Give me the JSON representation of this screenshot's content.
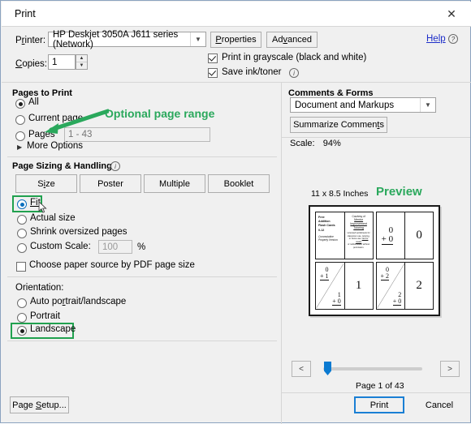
{
  "window": {
    "title": "Print",
    "close_icon": "close-icon"
  },
  "printer": {
    "label": "Printer:",
    "value": "HP Deskjet 3050A J611 series (Network)",
    "properties_label": "Properties",
    "advanced_label": "Advanced",
    "help_label": "Help",
    "help_icon": "question-circle-icon"
  },
  "copies": {
    "label": "Copies:",
    "value": "1"
  },
  "options": {
    "grayscale_label": "Print in grayscale (black and white)",
    "grayscale_checked": true,
    "saveink_label": "Save ink/toner",
    "saveink_checked": true,
    "saveink_info_icon": "info-circle-icon"
  },
  "pages_to_print": {
    "title": "Pages to Print",
    "items": [
      {
        "label": "All",
        "selected": true
      },
      {
        "label": "Current page",
        "selected": false
      },
      {
        "label": "Pages",
        "selected": false
      }
    ],
    "range_placeholder": "1 - 43",
    "more_options_label": "More Options",
    "more_options_icon": "triangle-right-icon"
  },
  "page_sizing": {
    "title": "Page Sizing & Handling",
    "info_icon": "info-circle-icon",
    "buttons": [
      "Size",
      "Poster",
      "Multiple",
      "Booklet"
    ],
    "radios": [
      {
        "label": "Fit",
        "selected": true
      },
      {
        "label": "Actual size",
        "selected": false
      },
      {
        "label": "Shrink oversized pages",
        "selected": false
      },
      {
        "label": "Custom Scale:",
        "selected": false
      }
    ],
    "custom_scale_value": "100",
    "percent_label": "%",
    "paper_source_label": "Choose paper source by PDF page size",
    "paper_source_checked": false
  },
  "orientation": {
    "title": "Orientation:",
    "items": [
      {
        "label": "Auto portrait/landscape",
        "selected": false
      },
      {
        "label": "Portrait",
        "selected": false
      },
      {
        "label": "Landscape",
        "selected": true
      }
    ]
  },
  "comments_forms": {
    "title": "Comments & Forms",
    "value": "Document and Markups",
    "summarize_label": "Summarize Comments"
  },
  "preview": {
    "scale_label": "Scale:",
    "scale_value": "94%",
    "size_label": "11 x 8.5 Inches",
    "page_status": "Page 1 of 43",
    "prev_label": "<",
    "next_label": ">",
    "cards": {
      "title_lines": [
        "Free",
        "Addition",
        "Flash Cards",
        "0-12"
      ],
      "subtitle_lines": [
        "Commutative",
        "Property Version"
      ],
      "courtesy_label": "Courtesy of",
      "courtesy_link": "Mental Improvement Tutoring",
      "courtesy_note": "Licensed worksheets for classroom use, tutoring, or home use. Not for resale or redistribution without permission.",
      "problems": [
        {
          "top": "0",
          "op": "+ 0",
          "answer": "0"
        },
        {
          "top": "0",
          "op": "+ 1",
          "top2": "1",
          "op2": "+ 0",
          "answer": "1"
        },
        {
          "top": "0",
          "op": "+ 2",
          "top2": "2",
          "op2": "+ 0",
          "answer": "2"
        }
      ]
    }
  },
  "footer": {
    "page_setup_label": "Page Setup...",
    "print_label": "Print",
    "cancel_label": "Cancel"
  },
  "annotations": {
    "page_range_note": "Optional page range",
    "preview_note": "Preview",
    "color": "#2aa85c"
  }
}
